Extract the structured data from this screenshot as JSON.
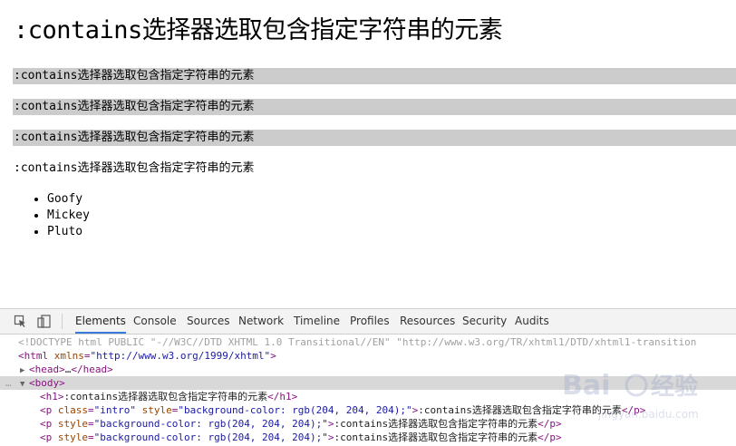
{
  "page": {
    "heading": ":contains选择器选取包含指定字符串的元素",
    "paragraphs": [
      {
        "text": ":contains选择器选取包含指定字符串的元素",
        "highlighted": true
      },
      {
        "text": ":contains选择器选取包含指定字符串的元素",
        "highlighted": true
      },
      {
        "text": ":contains选择器选取包含指定字符串的元素",
        "highlighted": true
      },
      {
        "text": ":contains选择器选取包含指定字符串的元素",
        "highlighted": false
      }
    ],
    "highlight_color": "#cccccc",
    "list": [
      "Goofy",
      "Mickey",
      "Pluto"
    ]
  },
  "devtools": {
    "icons": [
      "inspect-element-icon",
      "device-mode-icon"
    ],
    "tabs": [
      "Elements",
      "Console",
      "Sources",
      "Network",
      "Timeline",
      "Profiles",
      "Resources",
      "Security",
      "Audits"
    ],
    "active_tab": "Elements",
    "accent_color": "#3879d9",
    "dom": {
      "doctype": "<!DOCTYPE html PUBLIC \"-//W3C//DTD XHTML 1.0 Transitional//EN\" \"http://www.w3.org/TR/xhtml1/DTD/xhtml1-transition",
      "html_open": "<html",
      "html_attr": "xmlns",
      "html_val": "\"http://www.w3.org/1999/xhtml\"",
      "html_close": ">",
      "head": "<head>",
      "head_ellipsis": "…",
      "head_close": "</head>",
      "body": "<body>",
      "h1_open": "<h1>",
      "h1_text": ":contains选择器选取包含指定字符串的元素",
      "h1_close": "</h1>",
      "p1_open": "<p",
      "p1_attr1": "class",
      "p1_val1": "\"intro\"",
      "p_attr": "style",
      "p_val": "\"background-color: rgb(204, 204, 204);\"",
      "p_close_bracket": ">",
      "p_text": ":contains选择器选取包含指定字符串的元素",
      "p_end": "</p>",
      "eq": "="
    }
  },
  "watermark": {
    "brand": "Bai",
    "brand_tail": "经验",
    "url": "jingyan.baidu.com"
  }
}
